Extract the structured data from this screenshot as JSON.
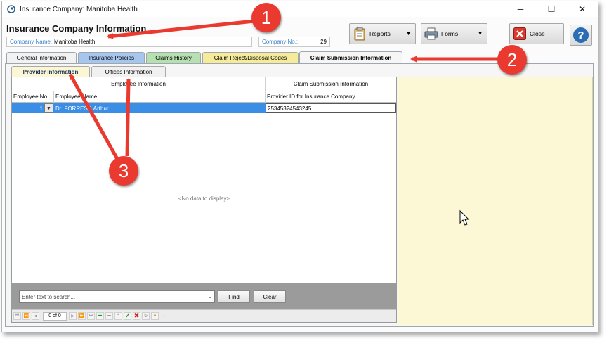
{
  "window": {
    "title": "Insurance Company:  Manitoba Health",
    "controls": {
      "minimize": "─",
      "maximize": "☐",
      "close": "✕"
    }
  },
  "header": {
    "title": "Insurance Company Information",
    "company_name_label": "Company Name:",
    "company_name_value": "Manitoba Health",
    "company_no_label": "Company No.:",
    "company_no_value": "29"
  },
  "toolbar": {
    "reports_label": "Reports",
    "forms_label": "Forms",
    "close_label": "Close",
    "help_label": "?"
  },
  "main_tabs": [
    {
      "label": "General Information",
      "color": "#f2f2f2"
    },
    {
      "label": "Insurance Policies",
      "color": "#a7c6ee"
    },
    {
      "label": "Claims History",
      "color": "#b7e0b1"
    },
    {
      "label": "Claim Reject/Disposal Codes",
      "color": "#f5eb9a"
    },
    {
      "label": "Claim Submission Information",
      "color": "#f6f6f6",
      "active": true
    }
  ],
  "sub_tabs": [
    {
      "label": "Provider Information",
      "active": true
    },
    {
      "label": "Offices Information",
      "active": false
    }
  ],
  "grid": {
    "bands": [
      "Employee Information",
      "Claim Submission Information"
    ],
    "columns": [
      "Employee No",
      "Employee Name",
      "Provider ID for Insurance Company"
    ],
    "rows": [
      {
        "employee_no": "1",
        "employee_name": "Dr. FORREST, Arthur",
        "provider_id": "25345324543245"
      }
    ],
    "empty_text": "<No data to display>"
  },
  "search": {
    "placeholder": "Enter text to search...",
    "find_label": "Find",
    "clear_label": "Clear"
  },
  "navigator": {
    "record_text": "0 of 0"
  },
  "callouts": [
    "1",
    "2",
    "3"
  ],
  "colors": {
    "accent_blue": "#3a8ee6",
    "callout_red": "#ea3a2f",
    "panel_yellow": "#fcf7d5"
  }
}
